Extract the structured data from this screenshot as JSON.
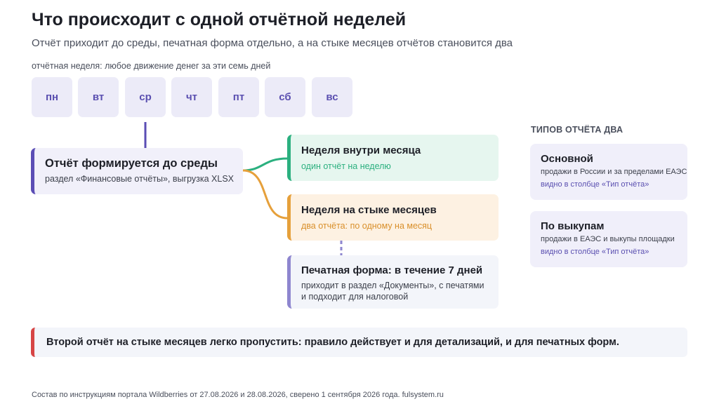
{
  "header": {
    "title": "Что происходит с одной отчётной неделей",
    "subtitle": "Отчёт приходит до среды, печатная форма отдельно, а на стыке месяцев отчётов становится два"
  },
  "week": {
    "label": "отчётная неделя: любое движение денег за эти семь дней",
    "days": [
      "пн",
      "вт",
      "ср",
      "чт",
      "пт",
      "сб",
      "вс"
    ]
  },
  "report": {
    "title": "Отчёт формируется до среды",
    "sub": "раздел «Финансовые отчёты», выгрузка XLSX"
  },
  "branches": {
    "inside": {
      "title": "Неделя внутри месяца",
      "sub": "один отчёт на неделю",
      "color": "#2bb07f"
    },
    "junction": {
      "title": "Неделя на стыке месяцев",
      "sub": "два отчёта: по одному на месяц",
      "color": "#e6a03b"
    },
    "print": {
      "title": "Печатная форма: в течение 7 дней",
      "sub1": "приходит в раздел «Документы», с печатями",
      "sub2": "и подходит для налоговой",
      "color": "#8e86cf"
    }
  },
  "types": {
    "title": "ТИПОВ ОТЧЁТА ДВА",
    "items": [
      {
        "title": "Основной",
        "line1": "продажи в России и за пределами ЕАЭС",
        "line2": "видно в столбце «Тип отчёта»"
      },
      {
        "title": "По выкупам",
        "line1": "продажи в ЕАЭС и выкупы площадки",
        "line2": "видно в столбце «Тип отчёта»"
      }
    ]
  },
  "warning": "Второй отчёт на стыке месяцев легко пропустить: правило действует и для детализаций, и для печатных форм.",
  "footer": "Состав по инструкциям портала Wildberries от 27.08.2026 и 28.08.2026, сверено 1 сентября 2026 года. fulsystem.ru",
  "colors": {
    "accent": "#5b4db5",
    "warning": "#d64545",
    "text": "#1d1f27"
  }
}
